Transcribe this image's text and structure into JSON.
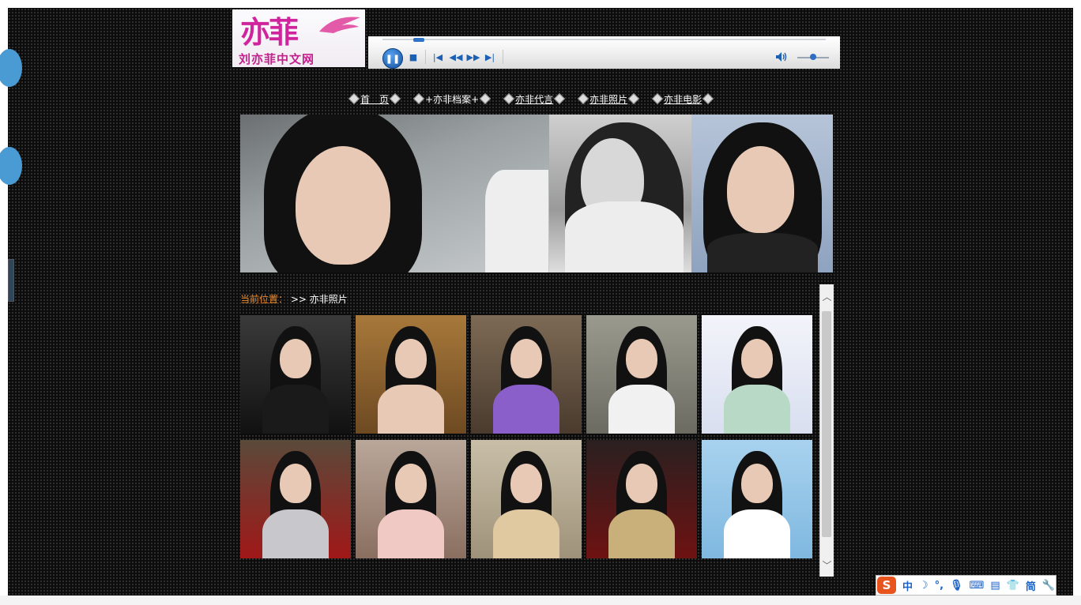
{
  "logo": {
    "mark": "亦菲",
    "caption": "刘亦菲中文网"
  },
  "player": {
    "progress": 0.07,
    "volume": 0.5,
    "icons": [
      "pause-icon",
      "stop-icon",
      "previous-icon",
      "rewind-icon",
      "fast-forward-icon",
      "next-icon",
      "speaker-icon"
    ]
  },
  "nav": {
    "items": [
      {
        "label": "首　页"
      },
      {
        "label": "+亦非档案+"
      },
      {
        "label": "亦非代言"
      },
      {
        "label": "亦非照片"
      },
      {
        "label": "亦非电影"
      }
    ]
  },
  "breadcrumb": {
    "label": "当前位置：",
    "path": ">> 亦非照片"
  },
  "gallery": {
    "count": 10
  },
  "ime": {
    "logo": "S",
    "mode": "中",
    "script": "简"
  },
  "colors": {
    "background": "#0c0c0c",
    "breadcrumb_label": "#f08a2a",
    "logo_pink": "#d0249d",
    "player_blue": "#1d5fb3",
    "ime_orange": "#e8541e"
  }
}
